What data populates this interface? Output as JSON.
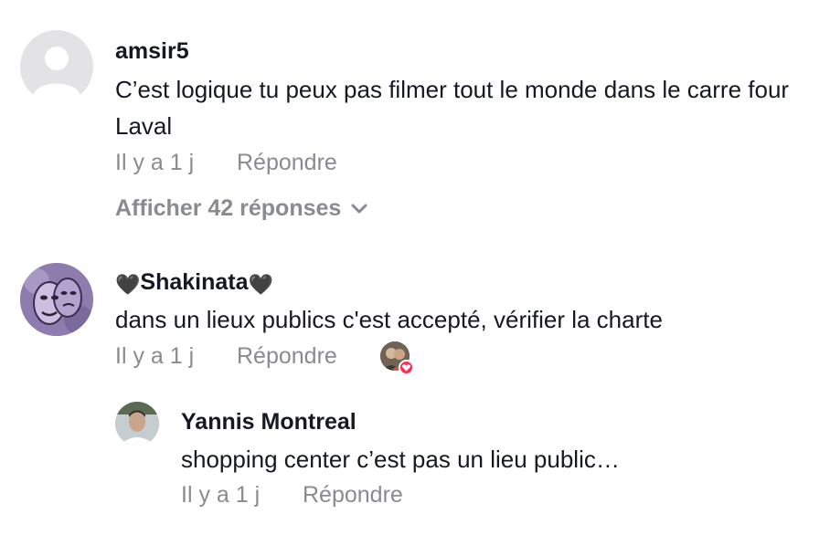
{
  "comments": [
    {
      "username": "amsir5",
      "text": "C’est logique tu peux pas filmer tout le monde dans le carre four Laval",
      "time": "Il y a 1 j",
      "reply_label": "Répondre",
      "view_replies": "Afficher 42 réponses",
      "avatar_icon": "default-user-icon"
    },
    {
      "username_prefix": "🖤",
      "username": "Shakinata",
      "username_suffix": "🖤",
      "text": "dans un lieux publics c'est accepté, vérifier la charte",
      "time": "Il y a 1 j",
      "reply_label": "Répondre",
      "liked_by_creator_icon": "creator-like-heart-icon"
    }
  ],
  "replies": [
    {
      "username": "Yannis Montreal",
      "text": "shopping center c’est pas un lieu public…",
      "time": "Il y a 1 j",
      "reply_label": "Répondre"
    }
  ],
  "colors": {
    "text": "#161823",
    "meta": "#8a8b91",
    "like_badge": "#fe2c55"
  }
}
